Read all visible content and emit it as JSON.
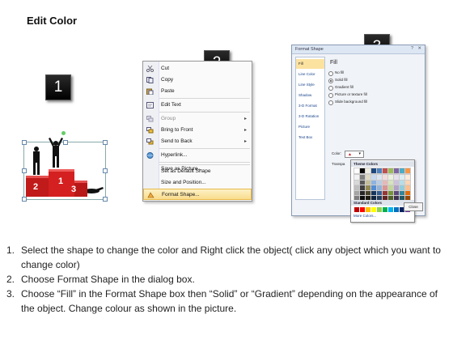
{
  "page": {
    "title": "Edit Color"
  },
  "badges": [
    "1",
    "2",
    "3"
  ],
  "podium": {
    "labels": [
      "2",
      "1",
      "3"
    ]
  },
  "context_menu": {
    "items": [
      {
        "label": "Cut",
        "icon": "scissors-icon"
      },
      {
        "label": "Copy",
        "icon": "copy-icon"
      },
      {
        "label": "Paste",
        "icon": "paste-icon"
      },
      {
        "label": "Edit Text",
        "icon": "edit-text-icon"
      },
      {
        "label": "Group",
        "icon": "group-icon",
        "submenu": true
      },
      {
        "label": "Bring to Front",
        "icon": "bring-front-icon",
        "submenu": true
      },
      {
        "label": "Send to Back",
        "icon": "send-back-icon",
        "submenu": true
      },
      {
        "label": "Hyperlink...",
        "icon": "hyperlink-icon"
      },
      {
        "label": "Save as Picture..."
      },
      {
        "label": "Set as Default Shape"
      },
      {
        "label": "Size and Position..."
      },
      {
        "label": "Format Shape...",
        "icon": "format-shape-icon",
        "highlighted": true
      }
    ]
  },
  "dialog": {
    "title": "Format Shape",
    "nav": [
      "Fill",
      "Line Color",
      "Line Style",
      "Shadow",
      "3-D Format",
      "3-D Rotation",
      "Picture",
      "Text Box"
    ],
    "section": "Fill",
    "options": [
      "No fill",
      "Solid fill",
      "Gradient fill",
      "Picture or texture fill",
      "Slide background fill"
    ],
    "color_label": "Color:",
    "transparency_label": "Transpa",
    "palette": {
      "theme_header": "Theme Colors",
      "standard_header": "Standard Colors",
      "more": "More Colors...",
      "theme_base": [
        "#ffffff",
        "#000000",
        "#eeece1",
        "#1f497d",
        "#4f81bd",
        "#c0504d",
        "#9bbb59",
        "#8064a2",
        "#4bacc6",
        "#f79646"
      ],
      "theme_rows": [
        [
          "#f2f2f2",
          "#7f7f7f",
          "#ddd9c3",
          "#c6d9f0",
          "#dbe5f1",
          "#f2dcdb",
          "#ebf1dd",
          "#e5e0ec",
          "#dbeef3",
          "#fdeada"
        ],
        [
          "#d8d8d8",
          "#595959",
          "#c4bd97",
          "#8db3e2",
          "#b8cce4",
          "#e5b9b7",
          "#d7e3bc",
          "#ccc1d9",
          "#b7dde8",
          "#fbd5b5"
        ],
        [
          "#bfbfbf",
          "#3f3f3f",
          "#938953",
          "#548dd4",
          "#95b3d7",
          "#d99694",
          "#c3d69b",
          "#b2a2c7",
          "#92cddc",
          "#fac08f"
        ],
        [
          "#a5a5a5",
          "#262626",
          "#494429",
          "#17365d",
          "#366092",
          "#953734",
          "#76923c",
          "#5f497a",
          "#31859b",
          "#e36c09"
        ],
        [
          "#7f7f7f",
          "#0c0c0c",
          "#1d1b10",
          "#0f243e",
          "#244061",
          "#632423",
          "#4f6128",
          "#3f3151",
          "#205867",
          "#974806"
        ]
      ],
      "standard": [
        "#c00000",
        "#ff0000",
        "#ffc000",
        "#ffff00",
        "#92d050",
        "#00b050",
        "#00b0f0",
        "#0070c0",
        "#002060",
        "#7030a0"
      ]
    },
    "close_label": "Close"
  },
  "steps": [
    {
      "num": "1.",
      "text": "Select the shape to change the color and Right click the object( click any object which you want to change color)"
    },
    {
      "num": "2.",
      "text": "Choose Format Shape in the dialog box."
    },
    {
      "num": "3.",
      "text": "Choose “Fill” in the Format Shape box then “Solid” or “Gradient” depending on the appearance of the object. Change colour as shown in the picture."
    }
  ]
}
